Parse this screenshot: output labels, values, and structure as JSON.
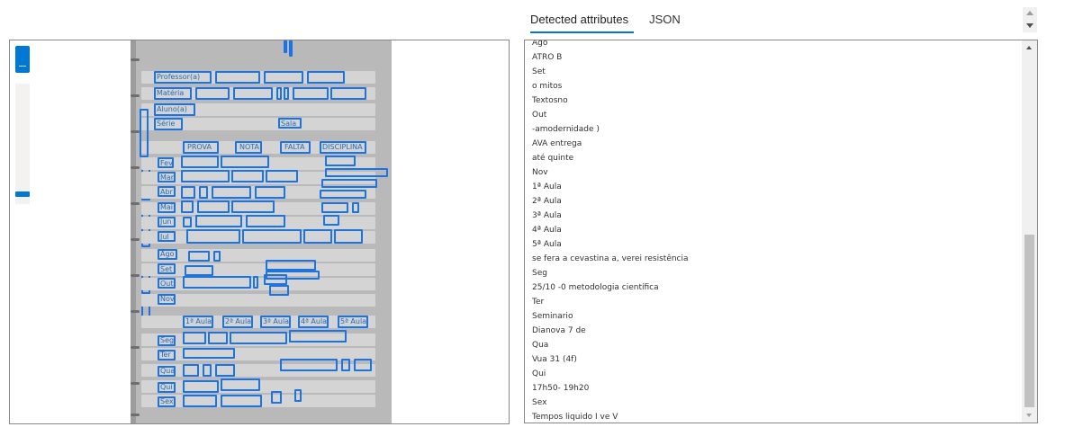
{
  "tabs": [
    {
      "label": "Detected attributes",
      "active": true
    },
    {
      "label": "JSON",
      "active": false
    }
  ],
  "image_labels": {
    "professor": "Professor(a)",
    "materia": "Matéria",
    "aluno": "Aluno(a)",
    "serie": "Série",
    "sala": "Sala",
    "prova": "PROVA",
    "nota": "NOTA",
    "falta": "FALTA",
    "disciplina": "DISCIPLINA",
    "months": [
      "Fev",
      "Mar",
      "Abr",
      "Mai",
      "Jun",
      "Jul",
      "Ago",
      "Set",
      "Out",
      "Nov"
    ],
    "aulas": [
      "1ª Aula",
      "2ª Aula",
      "3ª Aula",
      "4ª Aula",
      "5ª Aula"
    ],
    "days": [
      "Seg",
      "Ter",
      "Qua",
      "Qui",
      "Sex"
    ]
  },
  "attributes": [
    "Ago",
    "ATRO B",
    "Set",
    "o mitos",
    "Textosno",
    "Out",
    "-amodernidade )",
    "AVA entrega",
    "até quinte",
    "Nov",
    "1ª Aula",
    "2ª Aula",
    "3ª Aula",
    "4ª Aula",
    "5ª Aula",
    "se fera a cevastina a, verei resistência",
    "Seg",
    "25/10 -0 metodologia científica",
    "Ter",
    "Seminario",
    "Dianova 7 de",
    "Qua",
    "Vua 31 (4f)",
    "Qui",
    "17h50- 19h20",
    "Sex",
    "Tempos liquido I ve V"
  ]
}
